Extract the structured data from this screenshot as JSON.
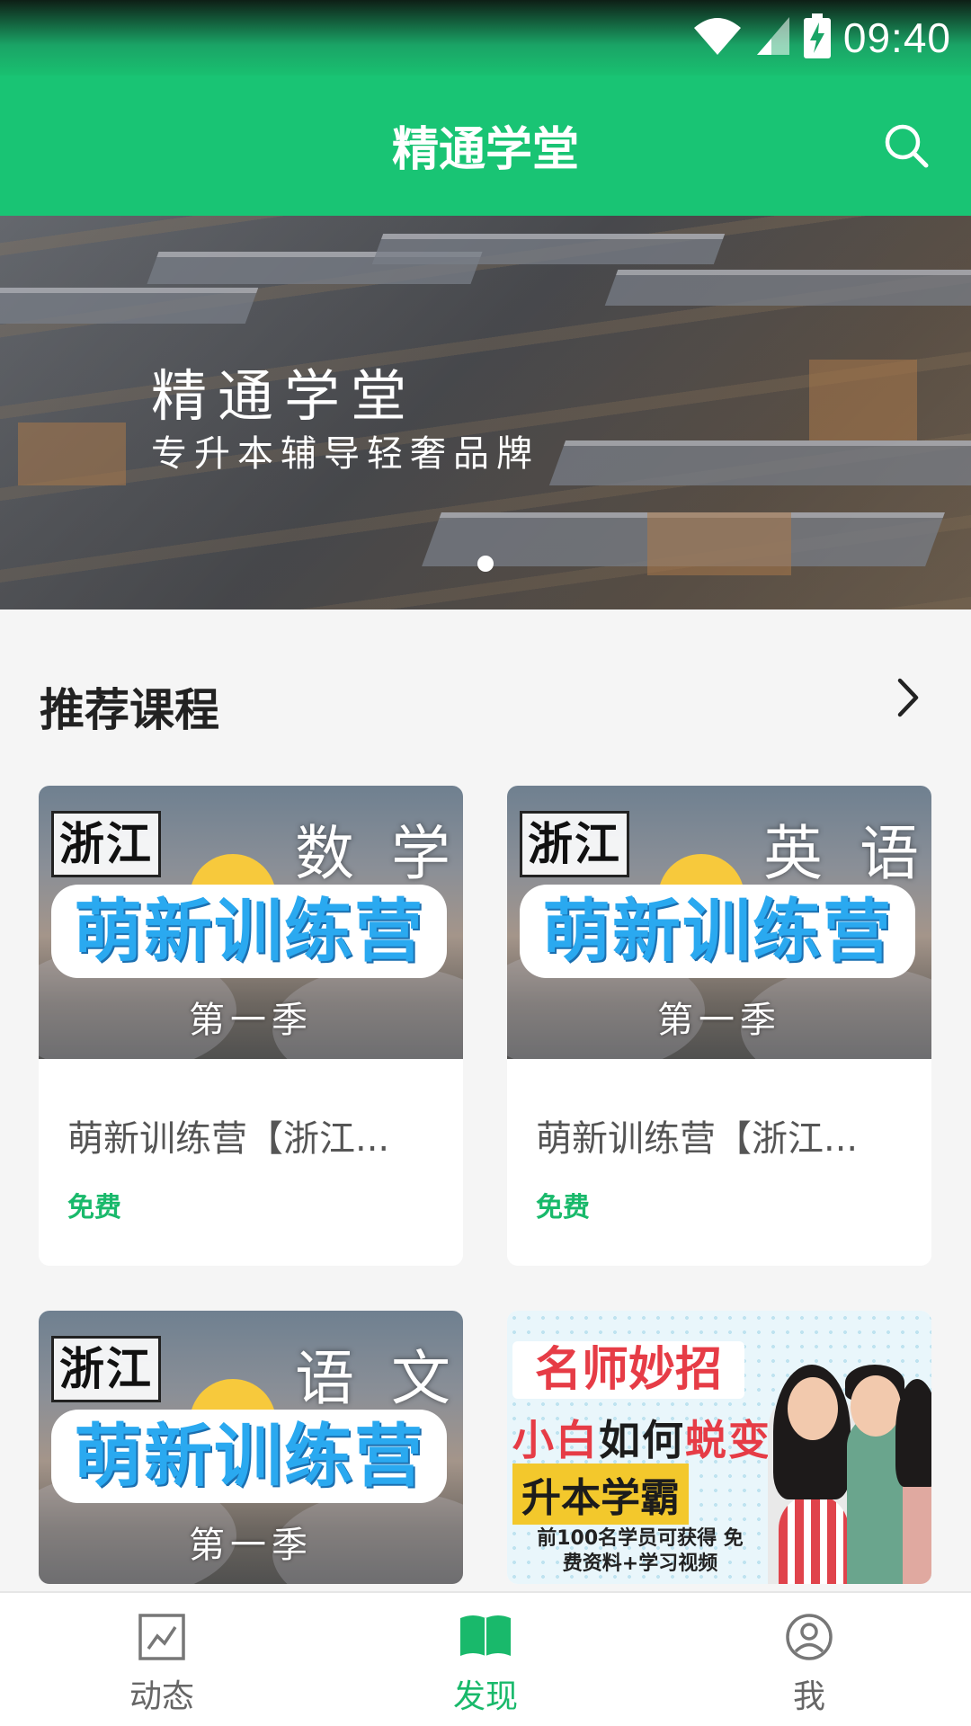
{
  "status_bar": {
    "time": "09:40"
  },
  "app_bar": {
    "title": "精通学堂"
  },
  "banner": {
    "title": "精通学堂",
    "subtitle": "专升本辅导轻奢品牌"
  },
  "section": {
    "title": "推荐课程"
  },
  "courses": [
    {
      "thumb_tag": "浙江",
      "thumb_subject": "数 学",
      "thumb_camp": "萌新训练营",
      "thumb_season": "第一季",
      "title": "萌新训练营【浙江...",
      "price": "免费"
    },
    {
      "thumb_tag": "浙江",
      "thumb_subject": "英 语",
      "thumb_camp": "萌新训练营",
      "thumb_season": "第一季",
      "title": "萌新训练营【浙江...",
      "price": "免费"
    },
    {
      "thumb_tag": "浙江",
      "thumb_subject": "语 文",
      "thumb_camp": "萌新训练营",
      "thumb_season": "第一季"
    },
    {
      "promo_head": "名师妙招",
      "promo_line1_a": "小白",
      "promo_line1_b": "如何",
      "promo_line1_c": "蜕变",
      "promo_line2": "升本学霸",
      "promo_line3": "前100名学员可获得 免费资料+学习视频"
    }
  ],
  "bottom_nav": [
    {
      "label": "动态",
      "icon": "chart-icon"
    },
    {
      "label": "发现",
      "icon": "book-icon"
    },
    {
      "label": "我",
      "icon": "profile-icon"
    }
  ],
  "colors": {
    "primary": "#19c474",
    "price": "#19b96b"
  }
}
